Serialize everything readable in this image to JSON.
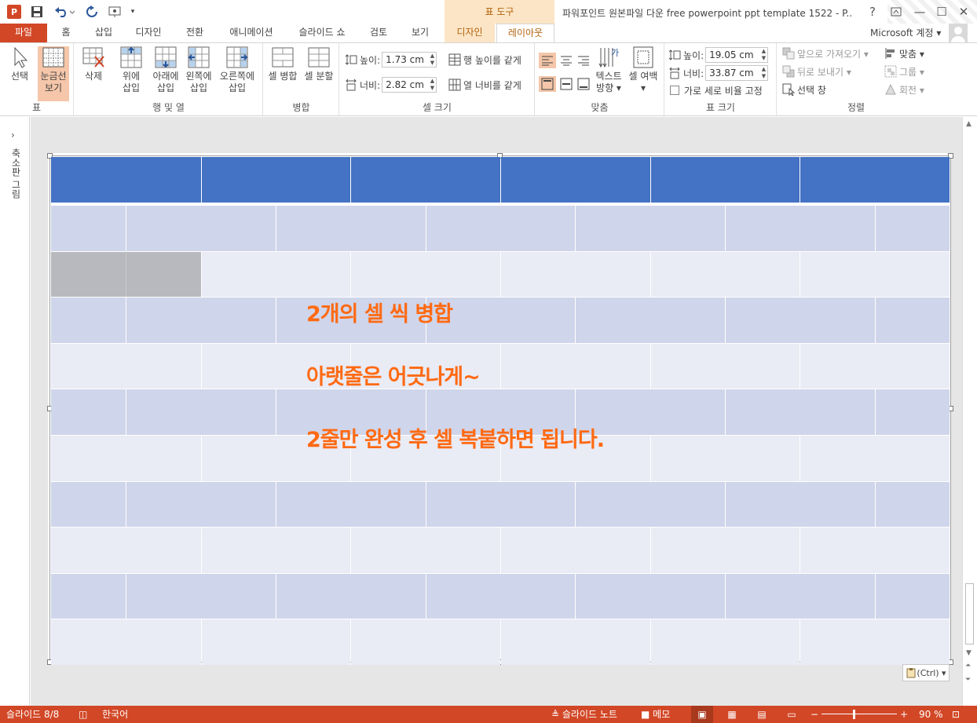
{
  "title_bar": {
    "document_title": "파워포인트 원본파일 다운 free powerpoint ppt template 1522 - P...",
    "contextual_tools_label": "표 도구",
    "logo_text": "P",
    "help_glyph": "?",
    "qat_more_glyph": "▾",
    "minimize_glyph": "—",
    "maximize_glyph": "☐",
    "close_glyph": "✕"
  },
  "tabs": {
    "file": "파일",
    "home": "홈",
    "insert": "삽입",
    "design": "디자인",
    "transitions": "전환",
    "animations": "애니메이션",
    "slideshow": "슬라이드 쇼",
    "review": "검토",
    "view": "보기",
    "tt_design": "디자인",
    "tt_layout": "레이아웃"
  },
  "account": {
    "name": "Microsoft 계정 ▾"
  },
  "ribbon": {
    "table_group": {
      "label": "표",
      "select": "선택",
      "gridlines": "눈금선\n보기"
    },
    "rowscols_group": {
      "label": "행 및 열",
      "delete": "삭제",
      "insert_above": "위에\n삽입",
      "insert_below": "아래에\n삽입",
      "insert_left": "왼쪽에\n삽입",
      "insert_right": "오른쪽에\n삽입"
    },
    "merge_group": {
      "label": "병합",
      "merge": "셀 병합",
      "split": "셀 분할"
    },
    "cellsize_group": {
      "label": "셀 크기",
      "height_label": "높이:",
      "height_value": "1.73 cm",
      "width_label": "너비:",
      "width_value": "2.82 cm",
      "distribute_rows": "행 높이를 같게",
      "distribute_cols": "열 너비를 같게"
    },
    "align_group": {
      "label": "맞춤",
      "text_direction": "텍스트\n방향 ▾",
      "cell_margins": "셀 여백\n▾"
    },
    "tablesize_group": {
      "label": "표 크기",
      "height_label": "높이:",
      "height_value": "19.05 cm",
      "width_label": "너비:",
      "width_value": "33.87 cm",
      "lock_ratio": "가로 세로 비율 고정"
    },
    "arrange_group": {
      "label": "정렬",
      "bring_forward": "앞으로 가져오기 ▾",
      "send_backward": "뒤로 보내기 ▾",
      "selection_pane": "선택 창",
      "align": "맞춤 ▾",
      "group": "그룹 ▾",
      "rotate": "회전 ▾"
    }
  },
  "thumb_pane": {
    "label": "축소판 그림",
    "expand_glyph": "›"
  },
  "slide": {
    "overlay_lines": [
      "2개의 셀 씩 병합",
      "아랫줄은 어긋나게~",
      "2줄만 완성 후 셀 복붙하면 됩니다."
    ],
    "paste_options": "(Ctrl) ▾",
    "colors": {
      "header": "#4472c4",
      "band_dark": "#cfd5ea",
      "band_light": "#e9ebf5",
      "merged_highlight": "#b8b9be",
      "text_accent": "#ff6a13"
    }
  },
  "scrollbar": {
    "up": "▲",
    "down": "▼",
    "prev": "⏶",
    "next": "⏷"
  },
  "status_bar": {
    "slide_info": "슬라이드 8/8",
    "spellcheck_icon": "◫",
    "language": "한국어",
    "notes": "≜ 슬라이드 노트",
    "comments": "■ 메모",
    "view_normal": "▣",
    "view_sorter": "▦",
    "view_reading": "▤",
    "view_show": "▭",
    "zoom_minus": "−",
    "zoom_plus": "+",
    "zoom_level": "90 %",
    "fit_icon": "⊡"
  }
}
